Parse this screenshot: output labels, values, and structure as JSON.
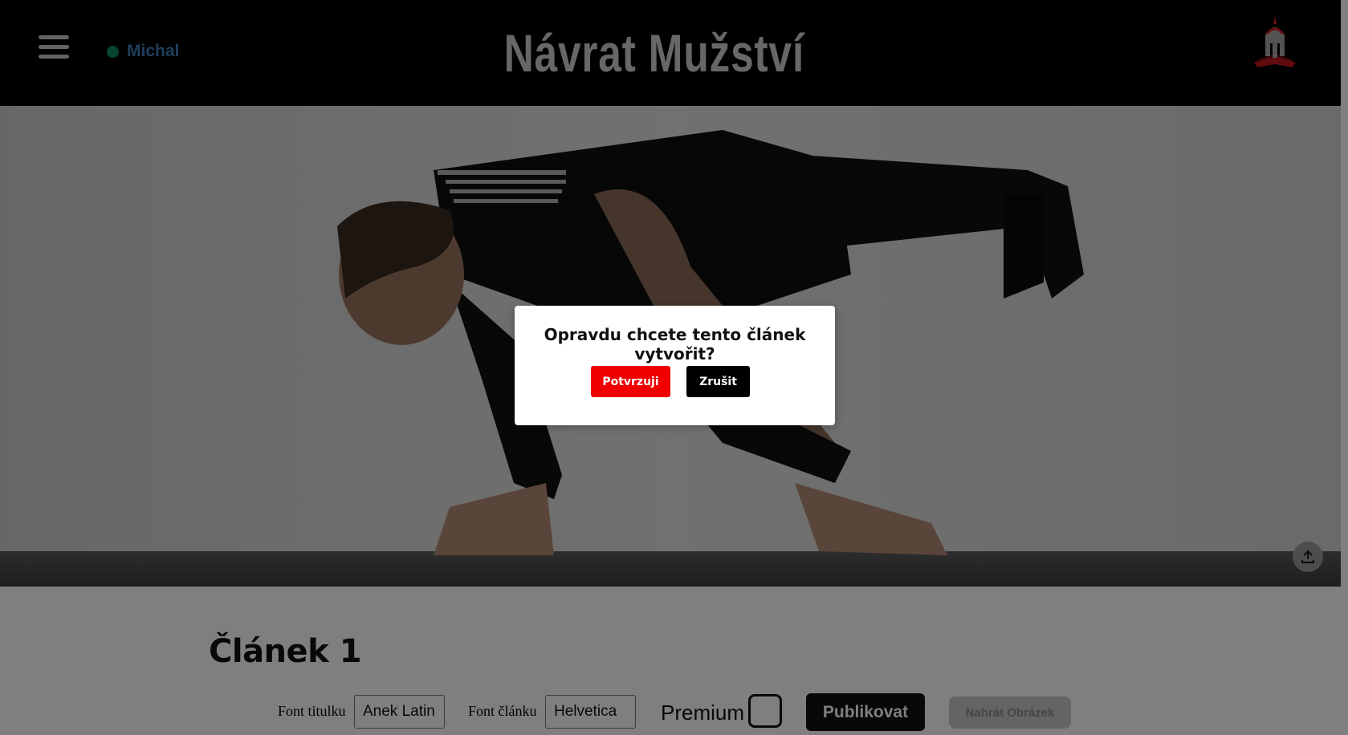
{
  "header": {
    "site_title": "Návrat Mužství",
    "user": {
      "name": "Michal",
      "status_color": "#0f8a60"
    }
  },
  "hero": {
    "image_description_icon": "upload-icon"
  },
  "article": {
    "title": "Článek 1"
  },
  "controls": {
    "title_font_label": "Font titulku",
    "title_font_value": "Anek Latin",
    "body_font_label": "Font článku",
    "body_font_value": "Helvetica",
    "premium_label": "Premium",
    "premium_checked": false,
    "publish_label": "Publikovat",
    "upload_image_label": "Nahrát Obrázek"
  },
  "modal": {
    "question": "Opravdu chcete tento článek vytvořit?",
    "confirm_label": "Potvrzuji",
    "cancel_label": "Zrušit",
    "confirm_color": "#f00000"
  }
}
